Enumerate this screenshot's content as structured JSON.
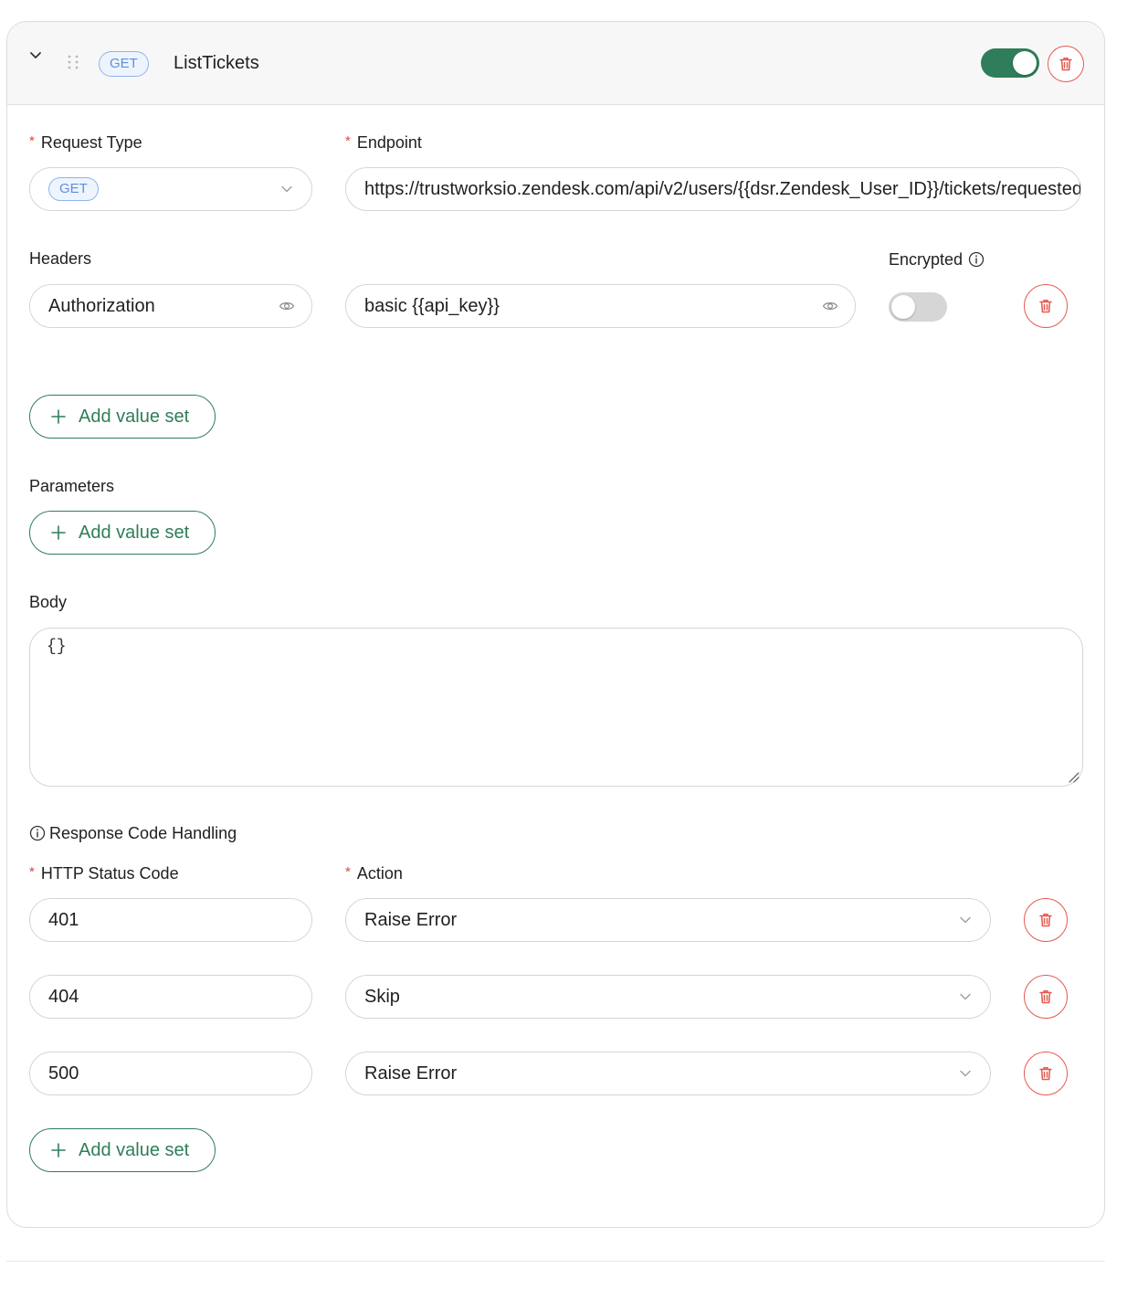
{
  "header": {
    "method_tag": "GET",
    "title": "ListTickets",
    "enabled": true
  },
  "request": {
    "type_label": "Request Type",
    "type_value": "GET",
    "endpoint_label": "Endpoint",
    "endpoint_value": "https://trustworksio.zendesk.com/api/v2/users/{{dsr.Zendesk_User_ID}}/tickets/requested"
  },
  "headers": {
    "label": "Headers",
    "encrypted_label": "Encrypted",
    "rows": [
      {
        "key": "Authorization",
        "value": "basic {{api_key}}",
        "encrypted": false
      }
    ],
    "add_label": "Add value set"
  },
  "parameters": {
    "label": "Parameters",
    "add_label": "Add value set"
  },
  "body": {
    "label": "Body",
    "value": "{}"
  },
  "response_handling": {
    "title": "Response Code Handling",
    "status_label": "HTTP Status Code",
    "action_label": "Action",
    "rows": [
      {
        "code": "401",
        "action": "Raise Error"
      },
      {
        "code": "404",
        "action": "Skip"
      },
      {
        "code": "500",
        "action": "Raise Error"
      }
    ],
    "add_label": "Add value set"
  },
  "colors": {
    "accent_green": "#2f7d5a",
    "danger_red": "#e5584f",
    "tag_blue": "#5f8fdc",
    "required_star": "#e0463a"
  },
  "icons": [
    "chevron-down-icon",
    "drag-handle-icon",
    "trash-icon",
    "eye-icon",
    "info-icon",
    "plus-icon",
    "resize-handle-icon"
  ]
}
